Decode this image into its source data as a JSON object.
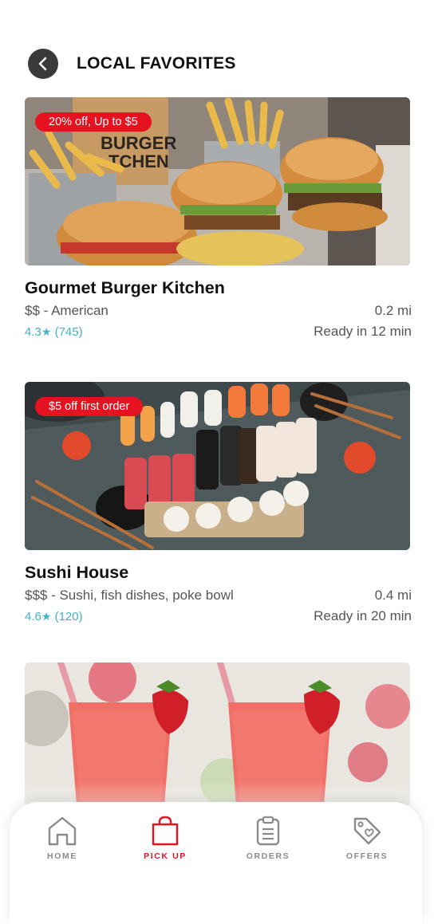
{
  "header": {
    "title": "LOCAL FAVORITES"
  },
  "colors": {
    "accent": "#e5121f",
    "rating": "#3fb2c6",
    "muted": "#555555",
    "tab_inactive": "#8a8a8a"
  },
  "restaurants": [
    {
      "promo": "20% off, Up to $5",
      "name": "Gourmet Burger Kitchen",
      "price_cuisine": "$$ - American",
      "distance": "0.2 mi",
      "rating": "4.3",
      "reviews": "(745)",
      "ready": "Ready in 12 min"
    },
    {
      "promo": "$5 off first order",
      "name": "Sushi House",
      "price_cuisine": "$$$ - Sushi, fish dishes, poke bowl",
      "distance": "0.4 mi",
      "rating": "4.6",
      "reviews": "(120)",
      "ready": "Ready in 20 min"
    },
    {}
  ],
  "tabs": [
    {
      "label": "HOME",
      "icon": "home-icon",
      "active": false
    },
    {
      "label": "PICK UP",
      "icon": "shopping-bag-icon",
      "active": true
    },
    {
      "label": "ORDERS",
      "icon": "clipboard-icon",
      "active": false
    },
    {
      "label": "OFFERS",
      "icon": "tag-icon",
      "active": false
    }
  ]
}
